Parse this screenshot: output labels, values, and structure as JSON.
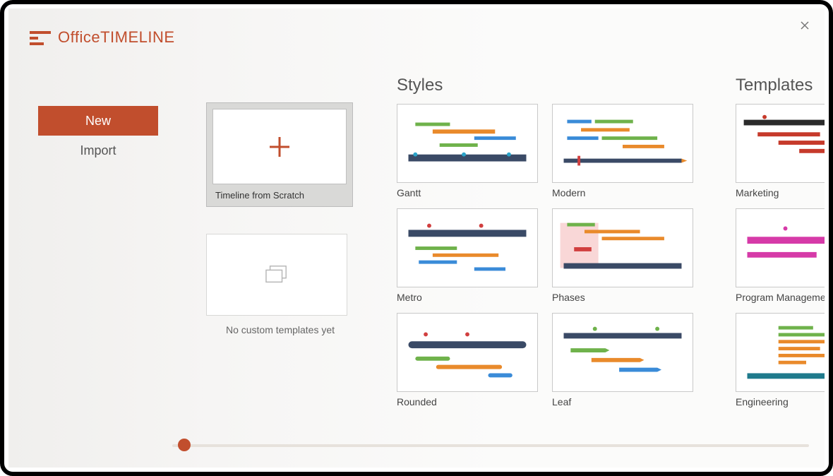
{
  "brand": {
    "name_light": "Office",
    "name_bold": "TIMELINE"
  },
  "nav": {
    "new": "New",
    "import": "Import"
  },
  "scratch": {
    "label": "Timeline from Scratch"
  },
  "no_custom": {
    "label": "No custom templates yet"
  },
  "sections": {
    "styles": "Styles",
    "templates": "Templates"
  },
  "styles": [
    {
      "label": "Gantt"
    },
    {
      "label": "Modern"
    },
    {
      "label": "Metro"
    },
    {
      "label": "Phases"
    },
    {
      "label": "Rounded"
    },
    {
      "label": "Leaf"
    }
  ],
  "templates": [
    {
      "label": "Marketing"
    },
    {
      "label": "Program Management"
    },
    {
      "label": "Engineering"
    }
  ],
  "colors": {
    "accent": "#c14e2d"
  }
}
